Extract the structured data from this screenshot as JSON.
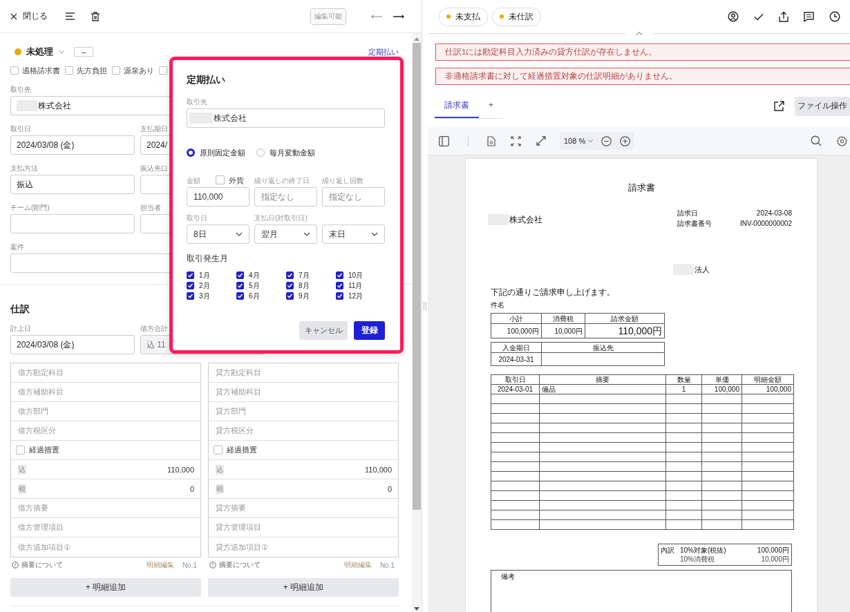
{
  "left_header": {
    "close_label": "閉じる",
    "edit_badge": "編集可能"
  },
  "status": {
    "label": "未処理",
    "color": "#e6ac00",
    "tag": "–"
  },
  "recurring_link": "定期払い",
  "flags": [
    {
      "label": "適格請求書",
      "checked": false
    },
    {
      "label": "先方負担",
      "checked": false
    },
    {
      "label": "源泉あり",
      "checked": false
    },
    {
      "checked": false
    }
  ],
  "form_rows": [
    {
      "fields": [
        {
          "label": "取引先",
          "value": "株式会社",
          "redacted": true
        }
      ]
    },
    {
      "fields": [
        {
          "label": "取引日",
          "value": "2024/03/08 (金)"
        },
        {
          "label": "支払期日",
          "value": "2024/"
        }
      ]
    },
    {
      "fields": [
        {
          "label": "支払方法",
          "value": "振込"
        },
        {
          "label": "振込先口"
        }
      ]
    },
    {
      "fields": [
        {
          "label": "チーム(部門)"
        },
        {
          "label": "担当者"
        }
      ]
    },
    {
      "fields": [
        {
          "label": "案件"
        }
      ]
    }
  ],
  "journal": {
    "title": "仕訳",
    "fields": [
      {
        "label": "計上日",
        "value": "2024/03/08 (金)",
        "disabled": false
      },
      {
        "label": "借方合計",
        "value": "込 11",
        "disabled": true
      }
    ],
    "entries": [
      {
        "rows": [
          {
            "kind": "placeholder",
            "text": "借方勘定科目"
          },
          {
            "kind": "placeholder",
            "text": "借方補助科目"
          },
          {
            "kind": "placeholder",
            "text": "借方部門"
          },
          {
            "kind": "placeholder",
            "text": "借方税区分"
          },
          {
            "kind": "checkbox",
            "text": "経過措置",
            "checked": false
          },
          {
            "kind": "amount",
            "badge": "込",
            "text": "110,000"
          },
          {
            "kind": "amount",
            "badge": "税",
            "text": "0"
          },
          {
            "kind": "placeholder",
            "text": "借方摘要"
          },
          {
            "kind": "placeholder",
            "text": "借方管理項目"
          },
          {
            "kind": "placeholder",
            "text": "借方追加項目①"
          }
        ],
        "note": "摘要について",
        "edit": "明細編集",
        "number": "No.1",
        "add": "+ 明細追加"
      },
      {
        "rows": [
          {
            "kind": "placeholder",
            "text": "貸方勘定科目"
          },
          {
            "kind": "placeholder",
            "text": "貸方補助科目"
          },
          {
            "kind": "placeholder",
            "text": "貸方部門"
          },
          {
            "kind": "placeholder",
            "text": "貸方税区分"
          },
          {
            "kind": "checkbox",
            "text": "経過措置",
            "checked": false
          },
          {
            "kind": "amount",
            "badge": "込",
            "text": "110,000"
          },
          {
            "kind": "amount",
            "badge": "税",
            "text": "0"
          },
          {
            "kind": "placeholder",
            "text": "貸方摘要"
          },
          {
            "kind": "placeholder",
            "text": "貸方管理項目"
          },
          {
            "kind": "placeholder",
            "text": "貸方追加項目①"
          }
        ],
        "note": "摘要について",
        "edit": "明細編集",
        "number": "No.1",
        "add": "+ 明細追加"
      }
    ]
  },
  "modal": {
    "title": "定期払い",
    "partner_label": "取引先",
    "partner_value": "株式会社",
    "amount_types": [
      {
        "label": "原則固定金額",
        "selected": true
      },
      {
        "label": "毎月変動金額",
        "selected": false
      }
    ],
    "amount": {
      "label": "金額",
      "value": "110,000"
    },
    "foreign_currency": {
      "label": "外貨",
      "checked": false
    },
    "end_date": {
      "label": "繰り返しの終了日",
      "placeholder": "指定なし"
    },
    "repeat_count": {
      "label": "繰り返し回数",
      "placeholder": "指定なし"
    },
    "transaction_day": {
      "label": "取引日",
      "value": "8日"
    },
    "payment_day": {
      "label": "支払日(対取引日)",
      "month": "翌月",
      "day": "末日"
    },
    "months_label": "取引発生月",
    "months": [
      {
        "label": "1月",
        "checked": true
      },
      {
        "label": "2月",
        "checked": true
      },
      {
        "label": "3月",
        "checked": true
      },
      {
        "label": "4月",
        "checked": true
      },
      {
        "label": "5月",
        "checked": true
      },
      {
        "label": "6月",
        "checked": true
      },
      {
        "label": "7月",
        "checked": true
      },
      {
        "label": "8月",
        "checked": true
      },
      {
        "label": "9月",
        "checked": true
      },
      {
        "label": "10月",
        "checked": true
      },
      {
        "label": "11月",
        "checked": true
      },
      {
        "label": "12月",
        "checked": true
      }
    ],
    "cancel": "キャンセル",
    "submit": "登録"
  },
  "status_pills": [
    {
      "label": "未支払",
      "color": "#e6ac00"
    },
    {
      "label": "未仕訳",
      "color": "#e6ac00"
    }
  ],
  "alerts": [
    "仕訳1には勘定科目入力済みの貸方仕訳が存在しません。",
    "非適格請求書に対して経過措置対象の仕訳明細がありません。"
  ],
  "doc_tabs": [
    {
      "label": "請求書",
      "selected": true
    },
    {
      "label": "+",
      "selected": false
    }
  ],
  "file_button": "ファイル操作",
  "viewer": {
    "zoom": "108 %"
  },
  "invoice": {
    "title": "請求書",
    "recipient": "株式会社",
    "meta": [
      {
        "label": "請求日",
        "value": "2024-03-08"
      },
      {
        "label": "請求書番号",
        "value": "INV-0000000002"
      }
    ],
    "issuer": "法人",
    "greeting": "下記の通りご請求申し上げます。",
    "subject_label": "件名",
    "summary": {
      "columns": [
        "小計",
        "消費税",
        "請求金額"
      ],
      "values": [
        "100,000円",
        "10,000円",
        "110,000円"
      ]
    },
    "payment": {
      "columns": [
        "入金期日",
        "振込先"
      ],
      "values": [
        "2024-03-31"
      ]
    },
    "items": {
      "columns": [
        "取引日",
        "摘要",
        "数量",
        "単価",
        "明細金額"
      ],
      "rows": [
        [
          "2024-03-01",
          "備品",
          "1",
          "100,000",
          "100,000"
        ]
      ]
    },
    "breakdown": {
      "label": "内訳",
      "rows": [
        {
          "name": "10%対象(税抜)",
          "value": "100,000円"
        },
        {
          "name": "10%消費税",
          "value": "10,000円"
        }
      ]
    },
    "remarks_label": "備考"
  }
}
